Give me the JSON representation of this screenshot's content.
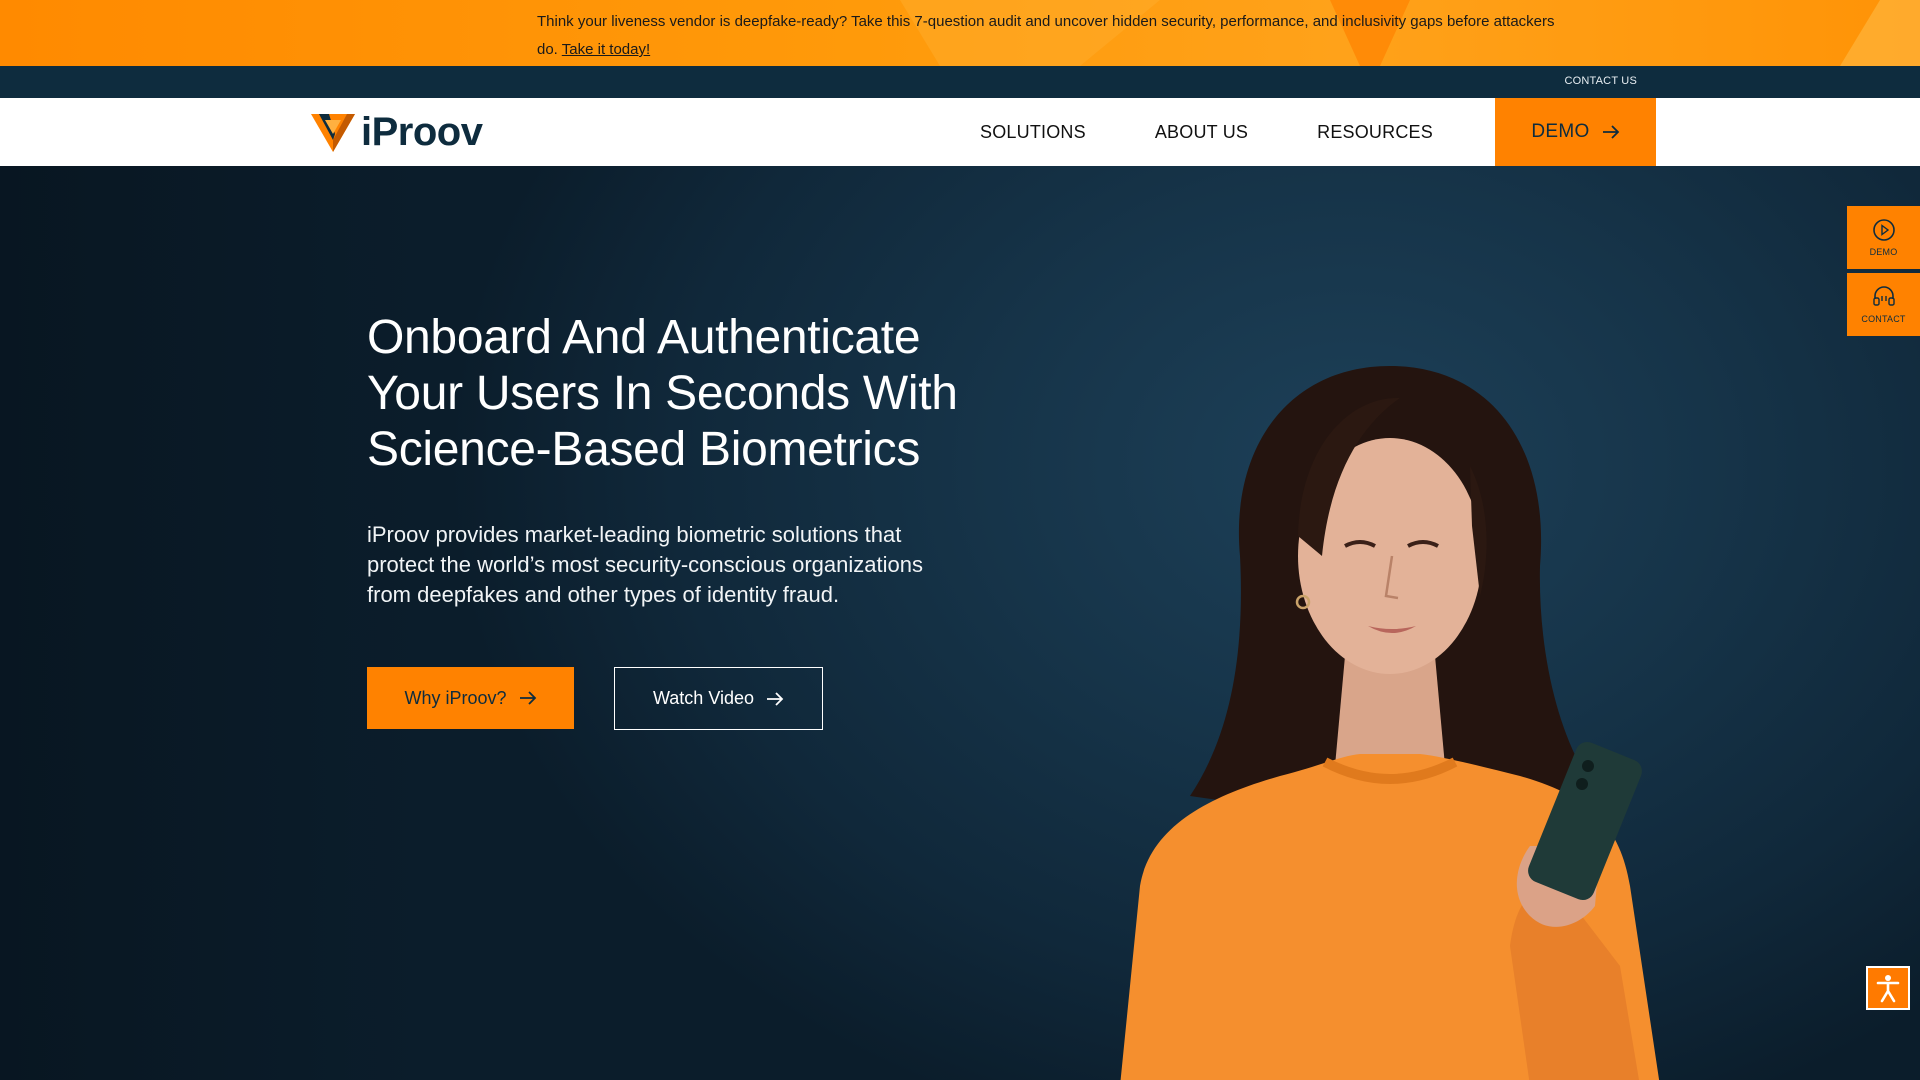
{
  "banner": {
    "text": "Think your liveness vendor is deepfake-ready? Take this 7-question audit and uncover hidden security, performance, and inclusivity gaps before attackers do.",
    "link_label": "Take it today!"
  },
  "utility_bar": {
    "contact_label": "CONTACT US"
  },
  "header": {
    "logo_text": "iProov",
    "nav": [
      {
        "label": "SOLUTIONS"
      },
      {
        "label": "ABOUT US"
      },
      {
        "label": "RESOURCES"
      }
    ],
    "demo_label": "DEMO"
  },
  "hero": {
    "title": "Onboard And Authenticate Your Users In Seconds With Science-Based Biometrics",
    "description": "iProov provides market-leading biometric solutions that protect the world’s most security-conscious organizations from deepfakes and other types of identity fraud.",
    "primary_button": "Why iProov?",
    "secondary_button": "Watch Video"
  },
  "side_widgets": {
    "demo_label": "DEMO",
    "contact_label": "CONTACT"
  },
  "icons": {
    "arrow": "arrow-right-icon",
    "play": "play-circle-icon",
    "headset": "headset-icon",
    "accessibility": "accessibility-icon"
  },
  "colors": {
    "brand_orange": "#ff8200",
    "navy": "#0e2c3e",
    "hero_bg": "#163449",
    "white": "#ffffff"
  }
}
